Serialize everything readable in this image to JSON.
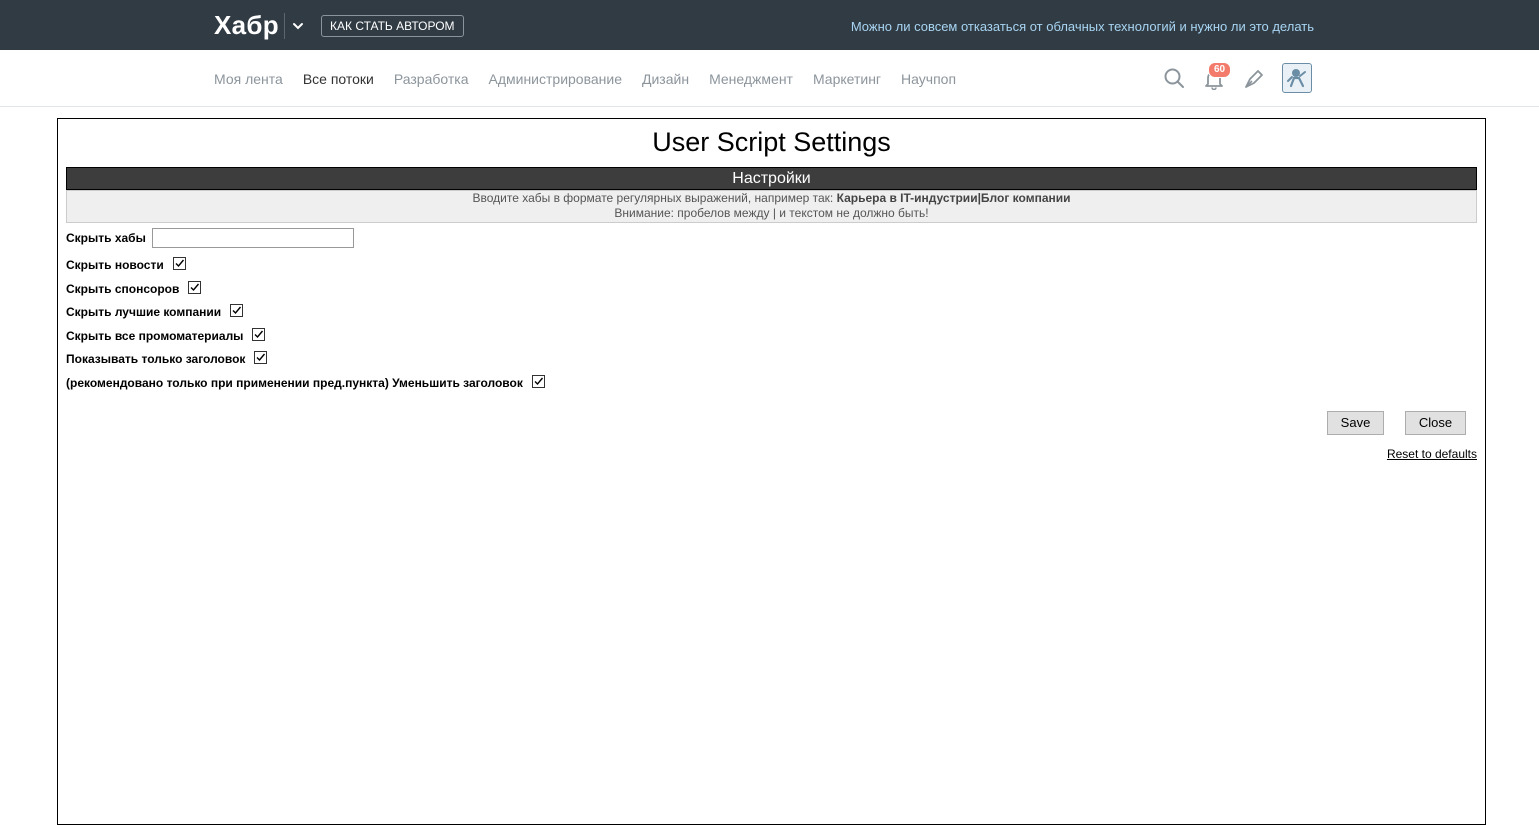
{
  "header": {
    "logo": "Хабр",
    "author_button": "КАК СТАТЬ АВТОРОМ",
    "promo_link": "Можно ли совсем отказаться от облачных технологий и нужно ли это делать"
  },
  "nav": {
    "items": [
      {
        "label": "Моя лента",
        "active": false
      },
      {
        "label": "Все потоки",
        "active": true
      },
      {
        "label": "Разработка",
        "active": false
      },
      {
        "label": "Администрирование",
        "active": false
      },
      {
        "label": "Дизайн",
        "active": false
      },
      {
        "label": "Менеджмент",
        "active": false
      },
      {
        "label": "Маркетинг",
        "active": false
      },
      {
        "label": "Научпоп",
        "active": false
      }
    ],
    "notification_count": "60",
    "icons": [
      "search-icon",
      "bell-icon",
      "pen-icon",
      "avatar-icon"
    ]
  },
  "dialog": {
    "title": "User Script Settings",
    "section_header": "Настройки",
    "hint_line1_prefix": "Вводите хабы в формате регулярных выражений, например так: ",
    "hint_line1_example": "Карьера в IT-индустрии|Блог компании",
    "hint_line2": "Внимание: пробелов между | и текстом не должно быть!",
    "hide_hubs_label": "Скрыть хабы",
    "hide_hubs_value": "",
    "options": [
      {
        "label": "Скрыть новости",
        "checked": true
      },
      {
        "label": "Скрыть спонсоров",
        "checked": true
      },
      {
        "label": "Скрыть лучшие компании",
        "checked": true
      },
      {
        "label": "Скрыть все промоматериалы",
        "checked": true
      },
      {
        "label": "Показывать только заголовок",
        "checked": true
      },
      {
        "label": "(рекомендовано только при применении пред.пункта) Уменьшить заголовок",
        "checked": true
      }
    ],
    "save_label": "Save",
    "close_label": "Close",
    "reset_label": "Reset to defaults"
  },
  "colors": {
    "topbar": "#303b44",
    "promo_link": "#a8d4f2",
    "badge": "#f37b6b",
    "section_header": "#3d3d3d"
  }
}
